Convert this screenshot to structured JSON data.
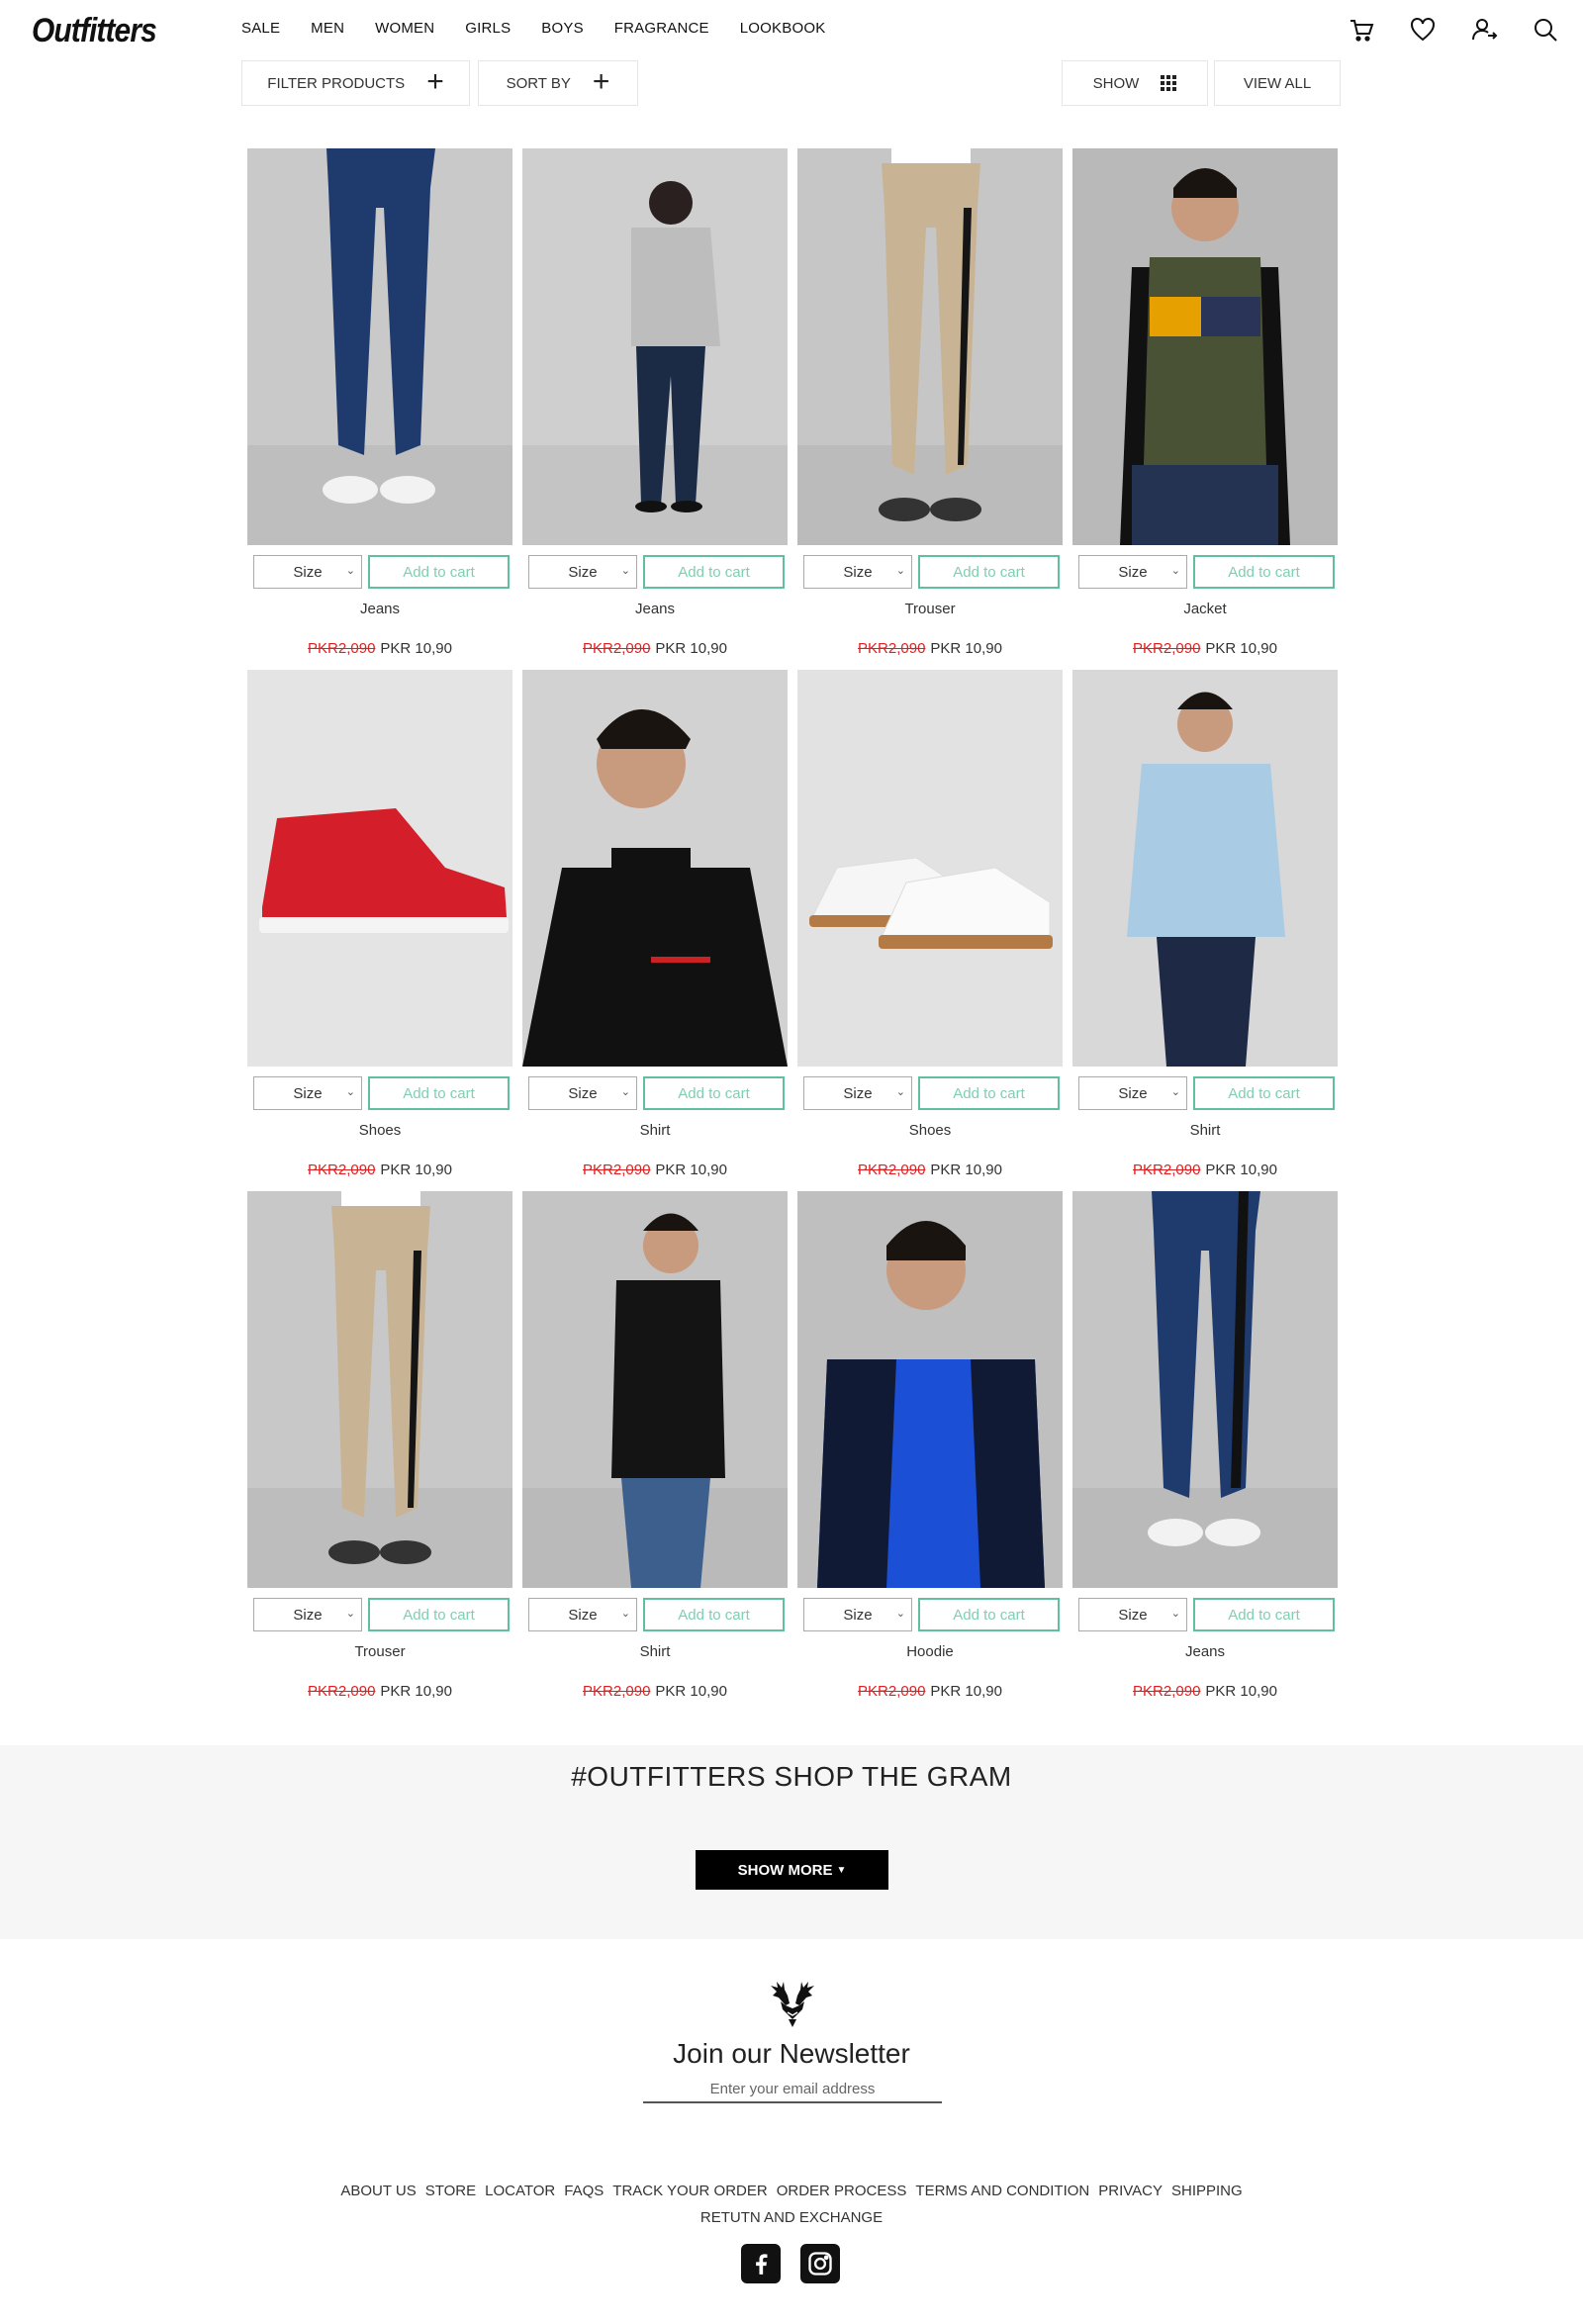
{
  "brand": {
    "logo": "Outfitters"
  },
  "nav": {
    "items": [
      {
        "label": "SALE"
      },
      {
        "label": "MEN"
      },
      {
        "label": "WOMEN"
      },
      {
        "label": "GIRLS"
      },
      {
        "label": "BOYS"
      },
      {
        "label": "FRAGRANCE"
      },
      {
        "label": "LOOKBOOK"
      }
    ],
    "icons": [
      "cart-icon",
      "heart-icon",
      "account-icon",
      "search-icon"
    ]
  },
  "toolbar": {
    "filter_label": "FILTER PRODUCTS",
    "sort_label": "SORT BY",
    "show_label": "SHOW",
    "view_all_label": "VIEW ALL"
  },
  "product_controls": {
    "size_label": "Size",
    "add_to_cart_label": "Add to cart"
  },
  "products": [
    {
      "name": "Jeans",
      "old_price": "PKR2,090",
      "price": "PKR 10,90",
      "image": "navy-jogger-pants",
      "bg": "#c9c9c9"
    },
    {
      "name": "Jeans",
      "old_price": "PKR2,090",
      "price": "PKR 10,90",
      "image": "model-grey-sweater-back",
      "bg": "#cfcfcf"
    },
    {
      "name": "Trouser",
      "old_price": "PKR2,090",
      "price": "PKR 10,90",
      "image": "khaki-trouser",
      "bg": "#c6c6c6"
    },
    {
      "name": "Jacket",
      "old_price": "PKR2,090",
      "price": "PKR 10,90",
      "image": "puffer-vest-model",
      "bg": "#b9b9b9"
    },
    {
      "name": "Shoes",
      "old_price": "PKR2,090",
      "price": "PKR 10,90",
      "image": "red-high-top-sneaker",
      "bg": "#e4e4e4"
    },
    {
      "name": "Shirt",
      "old_price": "PKR2,090",
      "price": "PKR 10,90",
      "image": "black-sweater-model",
      "bg": "#d2d2d2"
    },
    {
      "name": "Shoes",
      "old_price": "PKR2,090",
      "price": "PKR 10,90",
      "image": "white-sneakers",
      "bg": "#e2e2e2"
    },
    {
      "name": "Shirt",
      "old_price": "PKR2,090",
      "price": "PKR 10,90",
      "image": "light-blue-shirt-model",
      "bg": "#d8d8d8"
    },
    {
      "name": "Trouser",
      "old_price": "PKR2,090",
      "price": "PKR 10,90",
      "image": "khaki-jogger",
      "bg": "#c8c8c8"
    },
    {
      "name": "Shirt",
      "old_price": "PKR2,090",
      "price": "PKR 10,90",
      "image": "black-turtleneck-model",
      "bg": "#c4c4c4"
    },
    {
      "name": "Hoodie",
      "old_price": "PKR2,090",
      "price": "PKR 10,90",
      "image": "blue-hoodie-model",
      "bg": "#bfbfbf"
    },
    {
      "name": "Jeans",
      "old_price": "PKR2,090",
      "price": "PKR 10,90",
      "image": "navy-track-pants",
      "bg": "#c5c5c5"
    }
  ],
  "gram": {
    "title": "#OUTFITTERS SHOP THE GRAM",
    "show_more_label": "SHOW MORE"
  },
  "newsletter": {
    "title": "Join our Newsletter",
    "placeholder": "Enter your email address"
  },
  "footer": {
    "links_row1": [
      "ABOUT US",
      "STORE",
      "LOCATOR",
      "FAQS",
      "TRACK YOUR ORDER",
      "ORDER PROCESS",
      "TERMS AND CONDITION",
      "PRIVACY",
      "SHIPPING"
    ],
    "links_row2": [
      "RETUTN AND EXCHANGE"
    ],
    "social": [
      "facebook-icon",
      "instagram-icon"
    ]
  },
  "colors": {
    "accent_green": "#5fbf9f",
    "sale_red": "#e02020",
    "button_black": "#000000"
  }
}
